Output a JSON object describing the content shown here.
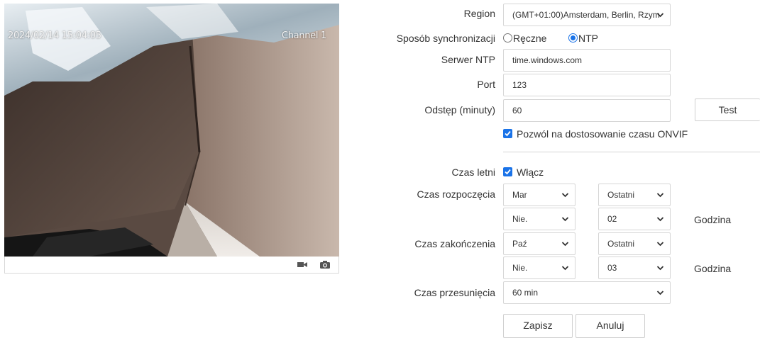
{
  "video": {
    "timestamp": "2024/02/14 15:04:05",
    "channel": "Channel 1",
    "toolbar": {
      "record_icon": "video-camera-icon",
      "snapshot_icon": "camera-icon"
    }
  },
  "form": {
    "region": {
      "label": "Region",
      "value": "(GMT+01:00)Amsterdam, Berlin, Rzym"
    },
    "sync": {
      "label": "Sposób synchronizacji",
      "options": [
        "Ręczne",
        "NTP"
      ],
      "selected": "NTP"
    },
    "ntp_server": {
      "label": "Serwer NTP",
      "value": "time.windows.com"
    },
    "port": {
      "label": "Port",
      "value": "123"
    },
    "interval": {
      "label": "Odstęp (minuty)",
      "value": "60",
      "test_button": "Test"
    },
    "onvif": {
      "label": "Pozwól na dostosowanie czasu ONVIF",
      "checked": true
    },
    "dst": {
      "label": "Czas letni",
      "checkbox_label": "Włącz",
      "checked": true
    },
    "start": {
      "label": "Czas rozpoczęcia",
      "month": "Mar",
      "week": "Ostatni",
      "day": "Nie.",
      "hour": "02",
      "hour_unit": "Godzina"
    },
    "end": {
      "label": "Czas zakończenia",
      "month": "Paź",
      "week": "Ostatni",
      "day": "Nie.",
      "hour": "03",
      "hour_unit": "Godzina"
    },
    "offset": {
      "label": "Czas przesunięcia",
      "value": "60 min"
    },
    "buttons": {
      "save": "Zapisz",
      "cancel": "Anuluj"
    }
  },
  "colors": {
    "accent": "#1a73e8",
    "border": "#d6d6d6",
    "text": "#333333"
  }
}
